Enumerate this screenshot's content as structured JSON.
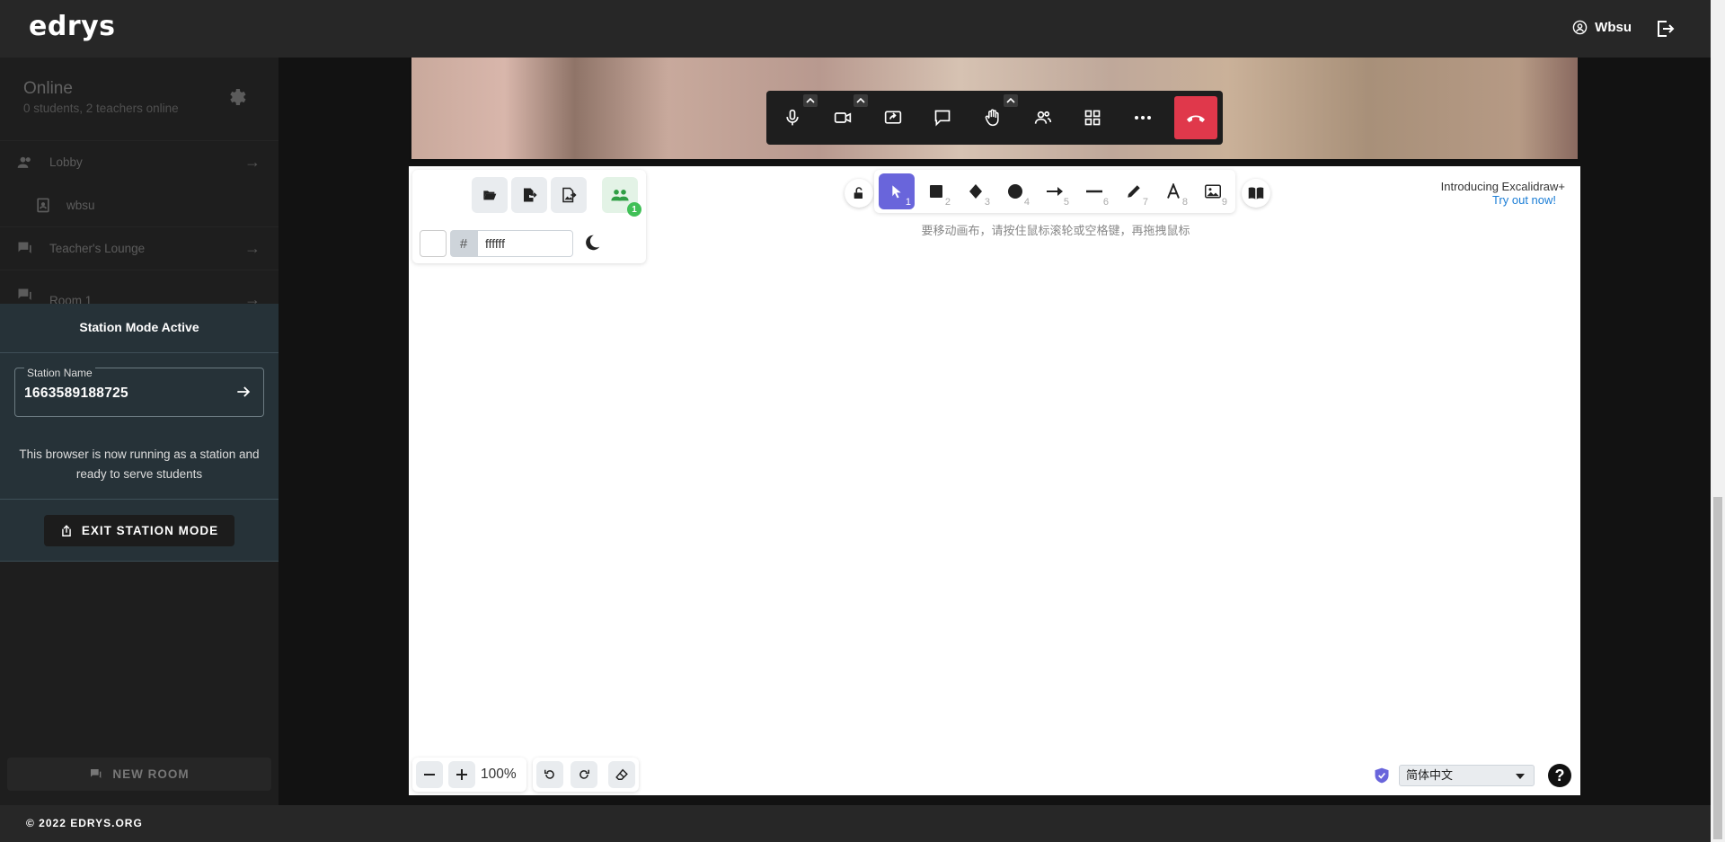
{
  "header": {
    "brand": "edrys",
    "user_name": "Wbsu"
  },
  "sidebar": {
    "online_title": "Online",
    "online_sub": "0 students, 2 teachers online",
    "rooms": [
      {
        "label": "Lobby"
      },
      {
        "label": "wbsu"
      },
      {
        "label": "Teacher's Lounge"
      },
      {
        "label": "Room 1"
      }
    ],
    "new_room_label": "NEW ROOM"
  },
  "station": {
    "title": "Station Mode Active",
    "field_label": "Station Name",
    "field_value": "1663589188725",
    "description": "This browser is now running as a station and ready to serve students",
    "exit_label": "EXIT STATION MODE"
  },
  "call_toolbar": {
    "buttons": [
      "microphone-icon",
      "camera-icon",
      "screenshare-icon",
      "chat-icon",
      "raise-hand-icon",
      "participants-icon",
      "tile-view-icon",
      "more-icon",
      "hangup-icon"
    ],
    "hangup_color": "#e0384b"
  },
  "excalidraw": {
    "collab_count": "1",
    "color_hash": "#",
    "bg_color_value": "ffffff",
    "tools": [
      {
        "name": "selection",
        "num": "1"
      },
      {
        "name": "rectangle",
        "num": "2"
      },
      {
        "name": "diamond",
        "num": "3"
      },
      {
        "name": "ellipse",
        "num": "4"
      },
      {
        "name": "arrow",
        "num": "5"
      },
      {
        "name": "line",
        "num": "6"
      },
      {
        "name": "draw",
        "num": "7"
      },
      {
        "name": "text",
        "num": "8"
      },
      {
        "name": "image",
        "num": "9"
      }
    ],
    "active_tool_color": "#6965db",
    "hint": "要移动画布，请按住鼠标滚轮或空格键，再拖拽鼠标",
    "promo_title": "Introducing Excalidraw+",
    "promo_link": "Try out now!",
    "zoom_value": "100%",
    "language": "简体中文",
    "help": "?"
  },
  "footer": {
    "text": "© 2022 EDRYS.ORG"
  }
}
